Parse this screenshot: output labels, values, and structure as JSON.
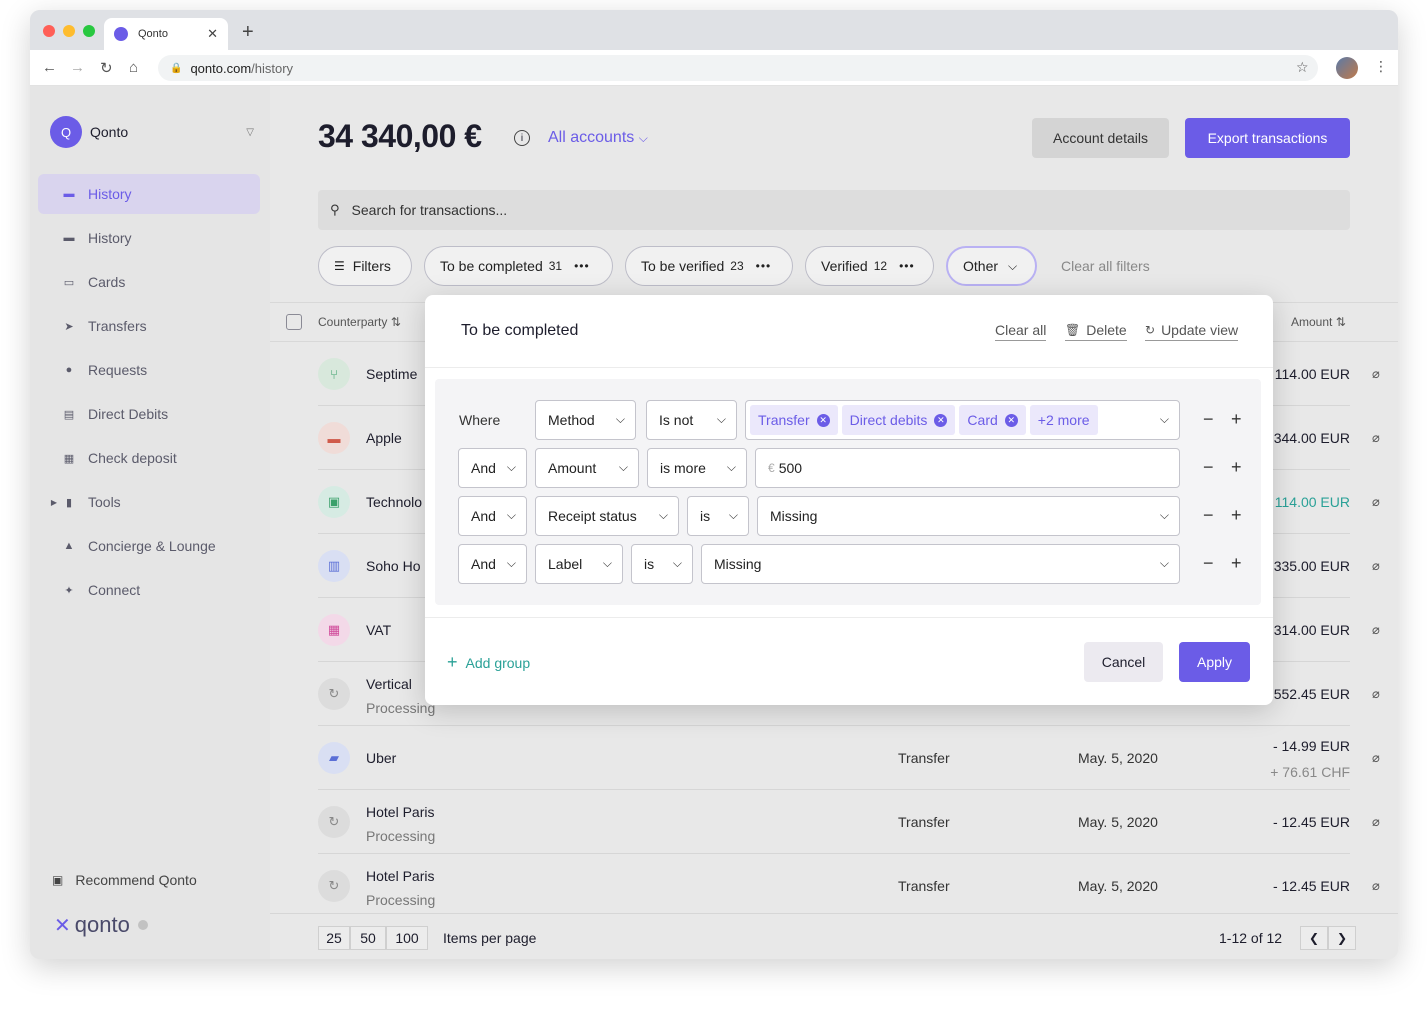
{
  "browser": {
    "tab_title": "Qonto",
    "url_host": "qonto.com",
    "url_path": "/history"
  },
  "sidebar": {
    "org_initial": "Q",
    "org_name": "Qonto",
    "items": [
      {
        "label": "History",
        "icon": "wallet-icon",
        "active": true
      },
      {
        "label": "History",
        "icon": "wallet-icon"
      },
      {
        "label": "Cards",
        "icon": "card-icon"
      },
      {
        "label": "Transfers",
        "icon": "send-icon"
      },
      {
        "label": "Requests",
        "icon": "chat-icon"
      },
      {
        "label": "Direct Debits",
        "icon": "debit-icon"
      },
      {
        "label": "Check deposit",
        "icon": "check-icon"
      },
      {
        "label": "Tools",
        "icon": "chart-icon"
      },
      {
        "label": "Concierge & Lounge",
        "icon": "bell-icon"
      },
      {
        "label": "Connect",
        "icon": "plug-icon"
      }
    ],
    "recommend": "Recommend Qonto",
    "brand": "qonto"
  },
  "header": {
    "balance": "34 340,00 €",
    "accounts_label": "All accounts",
    "account_details": "Account details",
    "export": "Export transactions",
    "search_placeholder": "Search for transactions..."
  },
  "filters": {
    "filters_label": "Filters",
    "to_be_completed": "To be completed",
    "to_be_completed_count": "31",
    "to_be_verified": "To be verified",
    "to_be_verified_count": "23",
    "verified": "Verified",
    "verified_count": "12",
    "other": "Other",
    "clear_all": "Clear all filters"
  },
  "table": {
    "col_counterparty": "Counterparty",
    "col_amount": "Amount",
    "rows": [
      {
        "name": "Septime",
        "sub": "",
        "method": "",
        "date": "",
        "amount": "114.00 EUR",
        "amount2": "",
        "color": "#1d1d2c"
      },
      {
        "name": "Apple",
        "sub": "",
        "method": "",
        "date": "",
        "amount": "344.00 EUR",
        "amount2": "",
        "color": "#1d1d2c"
      },
      {
        "name": "Technolo",
        "sub": "",
        "method": "",
        "date": "",
        "amount": "114.00 EUR",
        "amount2": "",
        "color": "#2aa197"
      },
      {
        "name": "Soho Ho",
        "sub": "",
        "method": "",
        "date": "",
        "amount": "335.00 EUR",
        "amount2": "",
        "color": "#1d1d2c"
      },
      {
        "name": "VAT",
        "sub": "",
        "method": "",
        "date": "",
        "amount": "314.00 EUR",
        "amount2": "",
        "color": "#1d1d2c"
      },
      {
        "name": "Vertical",
        "sub": "Processing",
        "method": "",
        "date": "",
        "amount": "552.45 EUR",
        "amount2": "",
        "color": "#1d1d2c"
      },
      {
        "name": "Uber",
        "sub": "",
        "method": "Transfer",
        "date": "May. 5, 2020",
        "amount": "- 14.99 EUR",
        "amount2": "+ 76.61 CHF",
        "color": "#1d1d2c"
      },
      {
        "name": "Hotel Paris",
        "sub": "Processing",
        "method": "Transfer",
        "date": "May. 5, 2020",
        "amount": "- 12.45 EUR",
        "amount2": "",
        "color": "#1d1d2c"
      },
      {
        "name": "Hotel Paris",
        "sub": "Processing",
        "method": "Transfer",
        "date": "May. 5, 2020",
        "amount": "- 12.45 EUR",
        "amount2": "",
        "color": "#1d1d2c"
      }
    ]
  },
  "pager": {
    "sizes": [
      "25",
      "50",
      "100"
    ],
    "items_per_page": "Items per page",
    "range": "1-12 of 12"
  },
  "modal": {
    "title": "To be completed",
    "clear_all": "Clear all",
    "delete": "Delete",
    "update_view": "Update view",
    "where": "Where",
    "row1": {
      "field": "Method",
      "op": "Is not",
      "chips": [
        "Transfer",
        "Direct debits",
        "Card"
      ],
      "more": "+2 more"
    },
    "row2": {
      "conj": "And",
      "field": "Amount",
      "op": "is more",
      "currency": "€",
      "value": "500"
    },
    "row3": {
      "conj": "And",
      "field": "Receipt status",
      "op": "is",
      "value": "Missing"
    },
    "row4": {
      "conj": "And",
      "field": "Label",
      "op": "is",
      "value": "Missing"
    },
    "add_group": "Add group",
    "cancel": "Cancel",
    "apply": "Apply"
  },
  "colors": {
    "accent": "#6b5ce7",
    "positive": "#2aa197"
  }
}
